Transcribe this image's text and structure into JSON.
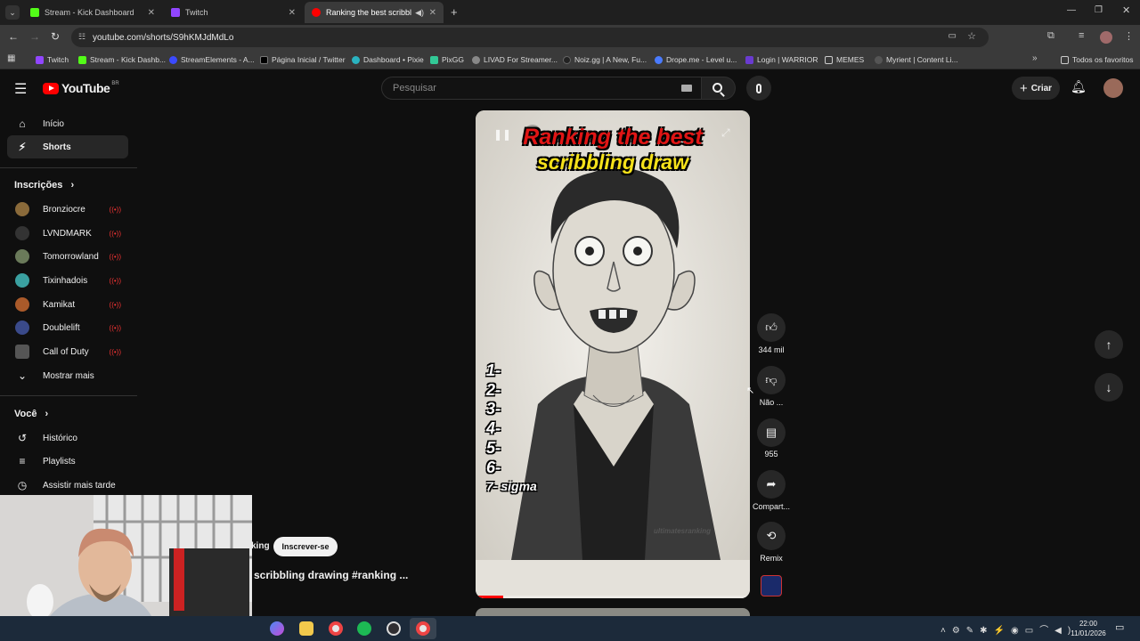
{
  "browser": {
    "tabs": [
      {
        "title": "Stream - Kick Dashboard",
        "color": "#53fc18"
      },
      {
        "title": "Twitch",
        "color": "#9146ff"
      },
      {
        "title": "Ranking the best scribbling",
        "color": "#ff0000"
      }
    ],
    "url": "youtube.com/shorts/S9hKMJdMdLo",
    "bookmarks": [
      {
        "label": "Twitch",
        "color": "#9146ff"
      },
      {
        "label": "Stream - Kick Dashb...",
        "color": "#53fc18"
      },
      {
        "label": "StreamElements - A...",
        "color": "#3b4aff"
      },
      {
        "label": "Página Inicial / Twitter",
        "color": "#000000"
      },
      {
        "label": "Dashboard • Pixie",
        "color": "#2ab3c0"
      },
      {
        "label": "PixGG",
        "color": "#32c896"
      },
      {
        "label": "LIVAD For Streamer...",
        "color": "#888888"
      },
      {
        "label": "Noiz.gg | A New, Fu...",
        "color": "#222222"
      },
      {
        "label": "Drope.me - Level u...",
        "color": "#4a7bff"
      },
      {
        "label": "Login | WARRIOR",
        "color": "#6a3bd0"
      },
      {
        "label": "MEMES",
        "color": "#cccccc"
      },
      {
        "label": "Myrient | Content Li...",
        "color": "#555555"
      }
    ],
    "all_favorites": "Todos os favoritos"
  },
  "youtube": {
    "logo_text": "YouTube",
    "logo_region": "BR",
    "search_placeholder": "Pesquisar",
    "create_label": "Criar",
    "sidebar": {
      "home": "Início",
      "shorts": "Shorts",
      "subscriptions_heading": "Inscrições",
      "channels": [
        {
          "name": "Bronziocre",
          "color": "#8a6a3a"
        },
        {
          "name": "LVNDMARK",
          "color": "#333333"
        },
        {
          "name": "Tomorrowland",
          "color": "#6a7a5a"
        },
        {
          "name": "Tixinhadois",
          "color": "#3aa0a0"
        },
        {
          "name": "Kamikat",
          "color": "#aa5a2a"
        },
        {
          "name": "Doublelift",
          "color": "#3a4a8a"
        },
        {
          "name": "Call of Duty",
          "color": "#555555"
        }
      ],
      "show_more": "Mostrar mais",
      "you_heading": "Você",
      "history": "Histórico",
      "playlists": "Playlists",
      "watch_later": "Assistir mais tarde"
    },
    "short": {
      "title_line1": "Ranking the best",
      "title_line2": "scribbling draw",
      "ranks": [
        "1-",
        "2-",
        "3-",
        "4-",
        "5-",
        "6-",
        "7- sigma"
      ],
      "watermark": "ultimatesranking",
      "channel_partial": "king",
      "subscribe_label": "Inscrever-se",
      "caption": "scribbling drawing #ranking ...",
      "progress": 0.1
    },
    "actions": {
      "likes": "344 mil",
      "dislike": "Não ...",
      "comments": "955",
      "share": "Compart...",
      "remix": "Remix"
    }
  },
  "taskbar": {
    "time": "22:00",
    "date": "11/01/2026"
  }
}
